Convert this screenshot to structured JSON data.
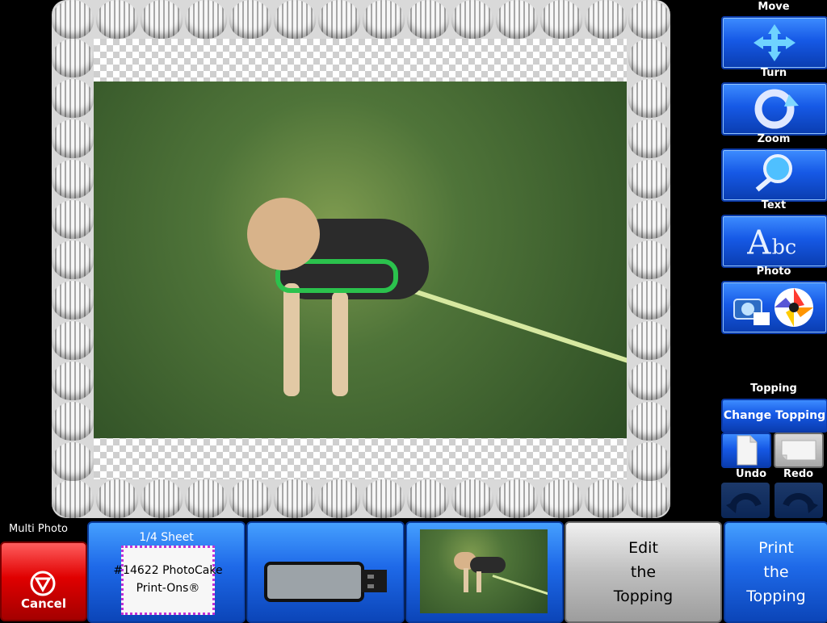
{
  "toolbar": {
    "move_label": "Move",
    "turn_label": "Turn",
    "zoom_label": "Zoom",
    "text_label": "Text",
    "photo_label": "Photo",
    "topping_label": "Topping",
    "change_topping_label": "Change Topping",
    "undo_label": "Undo",
    "redo_label": "Redo"
  },
  "bottom": {
    "multi_photo_label": "Multi Photo",
    "cancel_label": "Cancel",
    "sheet_label": "1/4 Sheet",
    "sheet_product": "#14622 PhotoCake",
    "sheet_product2": "Print-Ons®",
    "edit_line1": "Edit",
    "edit_line2": "the",
    "edit_line3": "Topping",
    "print_line1": "Print",
    "print_line2": "the",
    "print_line3": "Topping"
  },
  "colors": {
    "accent_blue": "#1e69e8",
    "cancel_red": "#e00000",
    "gray_button": "#bfbfbf"
  }
}
